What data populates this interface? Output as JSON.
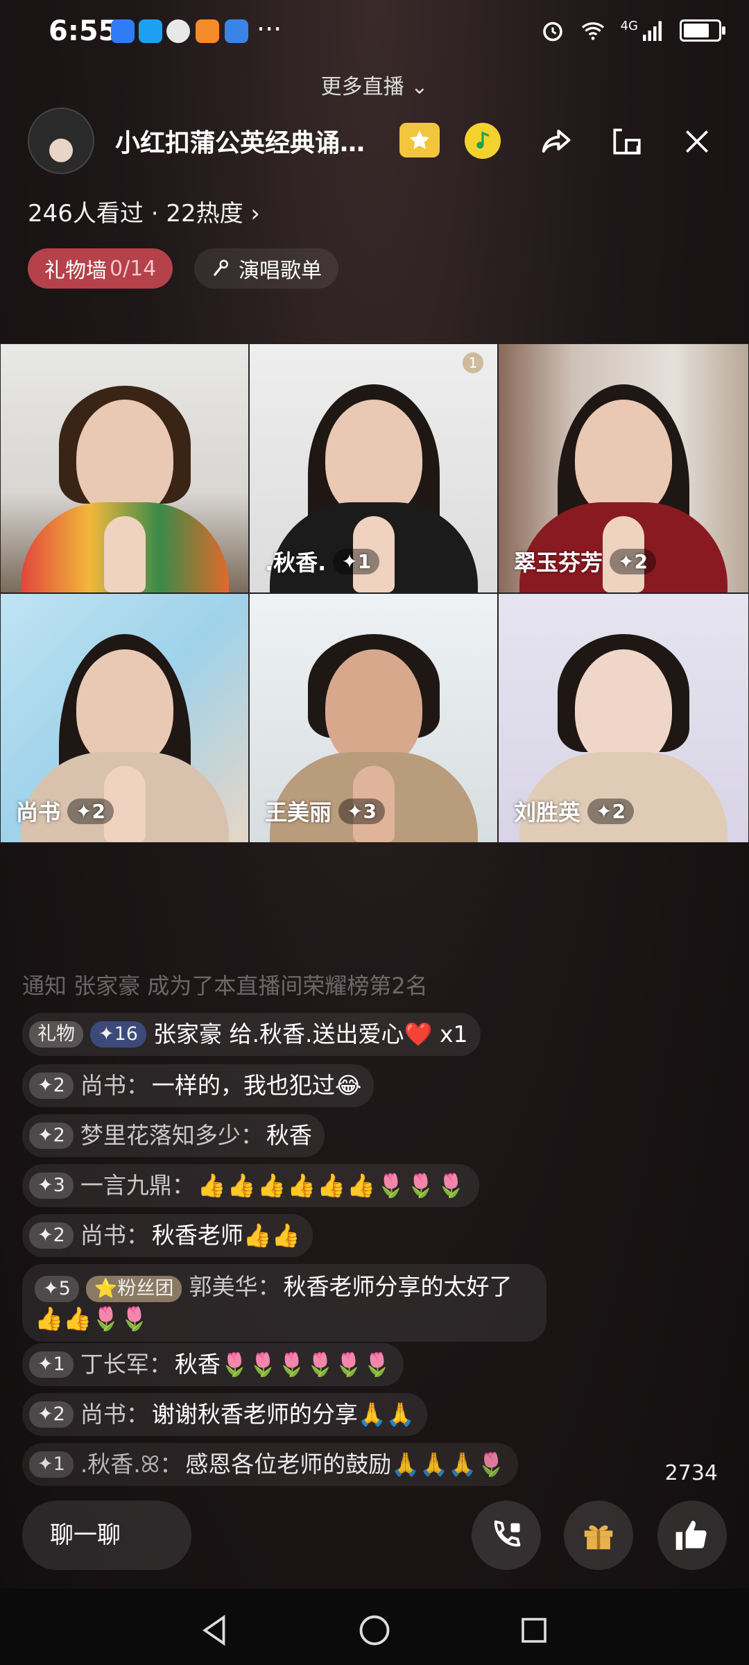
{
  "status_bar": {
    "time": "6:55",
    "dots": "···",
    "network": "4G"
  },
  "header": {
    "more_live": "更多直播 ⌄",
    "title": "小红扣蒲公英经典诵…",
    "stats": "246人看过 · 22热度 ›",
    "gift_wall_label": "礼物墙",
    "gift_wall_count": "0/14",
    "song_list": "演唱歌单"
  },
  "participants": [
    {
      "name": "",
      "level": "",
      "badge": ""
    },
    {
      "name": ".秋香.",
      "level": "✦1",
      "badge": "1"
    },
    {
      "name": "翠玉芬芳",
      "level": "✦2",
      "badge": ""
    },
    {
      "name": "尚书",
      "level": "✦2",
      "badge": ""
    },
    {
      "name": "王美丽",
      "level": "✦3",
      "badge": ""
    },
    {
      "name": "刘胜英",
      "level": "✦2",
      "badge": ""
    }
  ],
  "chat": {
    "notice": "通知 张家豪 成为了本直播间荣耀榜第2名",
    "messages": [
      {
        "tag": "礼物",
        "level": "✦16",
        "name": "",
        "text": "张家豪 给.秋香.送出爱心❤️ x1"
      },
      {
        "level": "✦2",
        "name": "尚书：",
        "text": "一样的，我也犯过😂"
      },
      {
        "level": "✦2",
        "name": "梦里花落知多少：",
        "text": "秋香"
      },
      {
        "level": "✦3",
        "name": "一言九鼎：",
        "text": "👍👍👍👍👍👍🌷🌷🌷"
      },
      {
        "level": "✦2",
        "name": "尚书：",
        "text": "秋香老师👍👍"
      },
      {
        "level": "✦5",
        "fans": "⭐粉丝团",
        "name": "郭美华：",
        "text": "秋香老师分享的太好了👍👍🌷🌷"
      },
      {
        "level": "✦1",
        "name": "丁长军：",
        "text": "秋香🌷🌷🌷🌷🌷🌷"
      },
      {
        "level": "✦2",
        "name": "尚书：",
        "text": "谢谢秋香老师的分享🙏🙏"
      },
      {
        "level": "✦1",
        "name": ".秋香.ꕤ：",
        "text": "感恩各位老师的鼓励🙏🙏🙏🌷"
      }
    ]
  },
  "like_count": "2734",
  "bottom": {
    "chat_placeholder": "聊一聊"
  },
  "colors": {
    "accent_red": "#b5414a",
    "star_yellow": "#f2c53d"
  }
}
